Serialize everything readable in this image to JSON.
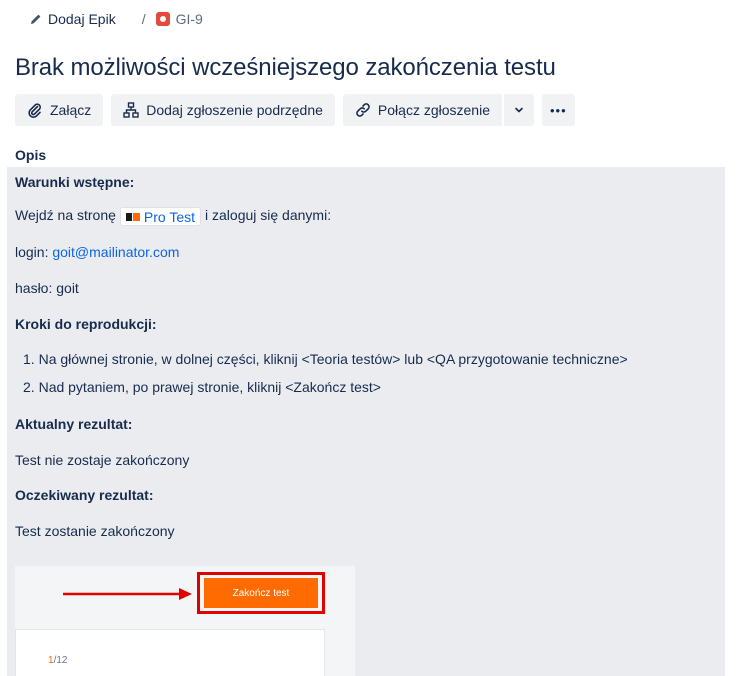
{
  "breadcrumb": {
    "epic_label": "Dodaj Epik",
    "separator": "/",
    "issue_key": "GI-9"
  },
  "issue": {
    "title": "Brak możliwości wcześniejszego zakończenia testu"
  },
  "toolbar": {
    "attach_label": "Załącz",
    "add_child_label": "Dodaj zgłoszenie podrzędne",
    "link_issue_label": "Połącz zgłoszenie",
    "more_label": "•••"
  },
  "description": {
    "label": "Opis",
    "preconditions_heading": "Warunki wstępne:",
    "go_to_prefix": "Wejdź na stronę",
    "link_chip": "Pro Test",
    "go_to_suffix": "i zaloguj się danymi:",
    "login_label": "login:",
    "login_value": "goit@mailinator.com",
    "password_line": "hasło: goit",
    "steps_heading": "Kroki do reprodukcji:",
    "steps": [
      {
        "number": "1.",
        "text": "Na głównej stronie, w dolnej części, kliknij <Teoria testów> lub <QA przygotowanie techniczne>"
      },
      {
        "number": "2.",
        "text": "Nad pytaniem, po prawej stronie, kliknij <Zakończ test>"
      }
    ],
    "actual_heading": "Aktualny rezultat:",
    "actual_text": "Test nie zostaje zakończony",
    "expected_heading": "Oczekiwany rezultat:",
    "expected_text": "Test zostanie zakończony"
  },
  "screenshot": {
    "button_label": "Zakończ test",
    "counter_current": "1",
    "counter_total": "/12"
  },
  "colors": {
    "accent_link": "#0c66e4",
    "bug": "#e5493a",
    "highlight": "#e00000",
    "app_button": "#ff6b00"
  }
}
